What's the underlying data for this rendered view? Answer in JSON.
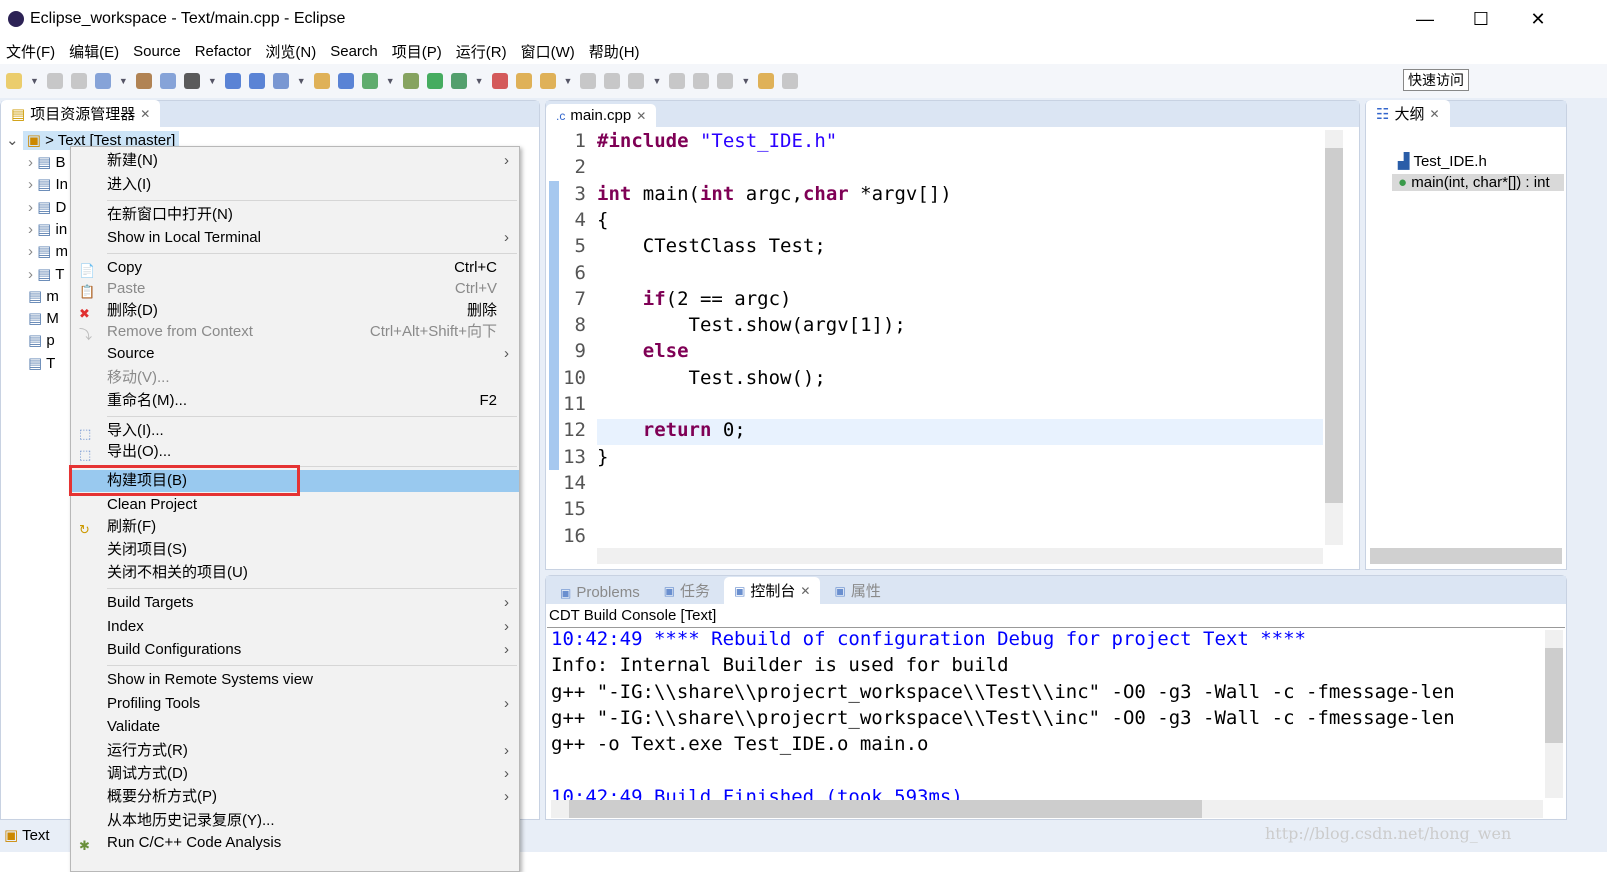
{
  "window": {
    "title": "Eclipse_workspace - Text/main.cpp - Eclipse",
    "minimize": "—",
    "maximize": "☐",
    "close": "✕"
  },
  "menu": [
    "文件(F)",
    "编辑(E)",
    "Source",
    "Refactor",
    "浏览(N)",
    "Search",
    "项目(P)",
    "运行(R)",
    "窗口(W)",
    "帮助(H)"
  ],
  "toolbar": {
    "quick_access": "快速访问"
  },
  "explorer": {
    "tab": "项目资源管理器",
    "root": "> Text [Test master]",
    "items": [
      "B",
      "In",
      "D",
      "in",
      "m",
      "T",
      "m",
      "M",
      "p",
      "T"
    ]
  },
  "context_menu": [
    {
      "label": "新建(N)",
      "arrow": true
    },
    {
      "label": "进入(I)"
    },
    {
      "label": "在新窗口中打开(N)"
    },
    {
      "label": "Show in Local Terminal",
      "arrow": true
    },
    {
      "label": "Copy",
      "shortcut": "Ctrl+C",
      "icon": "copy"
    },
    {
      "label": "Paste",
      "shortcut": "Ctrl+V",
      "disabled": true,
      "icon": "paste"
    },
    {
      "label": "删除(D)",
      "shortcut": "删除",
      "icon": "delete"
    },
    {
      "label": "Remove from Context",
      "shortcut": "Ctrl+Alt+Shift+向下",
      "disabled": true,
      "icon": "remove"
    },
    {
      "label": "Source",
      "arrow": true
    },
    {
      "label": "移动(V)...",
      "disabled": true
    },
    {
      "label": "重命名(M)...",
      "shortcut": "F2"
    },
    {
      "label": "导入(I)...",
      "icon": "import"
    },
    {
      "label": "导出(O)...",
      "icon": "export"
    },
    {
      "label": "构建项目(B)",
      "highlighted": true
    },
    {
      "label": "Clean Project"
    },
    {
      "label": "刷新(F)",
      "icon": "refresh"
    },
    {
      "label": "关闭项目(S)"
    },
    {
      "label": "关闭不相关的项目(U)"
    },
    {
      "label": "Build Targets",
      "arrow": true
    },
    {
      "label": "Index",
      "arrow": true
    },
    {
      "label": "Build Configurations",
      "arrow": true
    },
    {
      "label": "Show in Remote Systems view"
    },
    {
      "label": "Profiling Tools",
      "arrow": true
    },
    {
      "label": "Validate"
    },
    {
      "label": "运行方式(R)",
      "arrow": true
    },
    {
      "label": "调试方式(D)",
      "arrow": true
    },
    {
      "label": "概要分析方式(P)",
      "arrow": true
    },
    {
      "label": "从本地历史记录复原(Y)..."
    },
    {
      "label": "Run C/C++ Code Analysis",
      "icon": "analysis"
    }
  ],
  "editor": {
    "tab": "main.cpp",
    "lines": [
      [
        [
          "pp",
          "#include "
        ],
        [
          "str",
          "\"Test_IDE.h\""
        ]
      ],
      [],
      [
        [
          "kw",
          "int"
        ],
        [
          "t",
          " main("
        ],
        [
          "kw",
          "int"
        ],
        [
          "t",
          " argc,"
        ],
        [
          "kw",
          "char"
        ],
        [
          "t",
          " *argv[])"
        ]
      ],
      [
        [
          "t",
          "{"
        ]
      ],
      [
        [
          "t",
          "    CTestClass Test;"
        ]
      ],
      [],
      [
        [
          "t",
          "    "
        ],
        [
          "kw",
          "if"
        ],
        [
          "t",
          "(2 == argc)"
        ]
      ],
      [
        [
          "t",
          "        Test.show(argv[1]);"
        ]
      ],
      [
        [
          "t",
          "    "
        ],
        [
          "kw",
          "else"
        ]
      ],
      [
        [
          "t",
          "        Test.show();"
        ]
      ],
      [],
      [
        [
          "t",
          "    "
        ],
        [
          "kw",
          "return"
        ],
        [
          "t",
          " 0;"
        ]
      ],
      [
        [
          "t",
          "}"
        ]
      ],
      [],
      [],
      []
    ]
  },
  "outline": {
    "tab": "大纲",
    "items": [
      "Test_IDE.h",
      "main(int, char*[]) : int"
    ]
  },
  "console": {
    "tabs": [
      "Problems",
      "任务",
      "控制台",
      "属性"
    ],
    "header": "CDT Build Console [Text]",
    "lines": [
      {
        "text": "10:42:49 **** Rebuild of configuration Debug for project Text ****",
        "color": "#0000ff"
      },
      {
        "text": "Info: Internal Builder is used for build"
      },
      {
        "text": "g++ \"-IG:\\\\share\\\\projecrt_workspace\\\\Test\\\\inc\" -O0 -g3 -Wall -c -fmessage-len"
      },
      {
        "text": "g++ \"-IG:\\\\share\\\\projecrt_workspace\\\\Test\\\\inc\" -O0 -g3 -Wall -c -fmessage-len"
      },
      {
        "text": "g++ -o Text.exe Test_IDE.o main.o"
      },
      {
        "text": ""
      },
      {
        "text": "10:42:49 Build Finished (took 593ms)",
        "color": "#0000ff"
      }
    ]
  },
  "statusbar": {
    "item": "Text",
    "watermark": "http://blog.csdn.net/hong_wen"
  }
}
